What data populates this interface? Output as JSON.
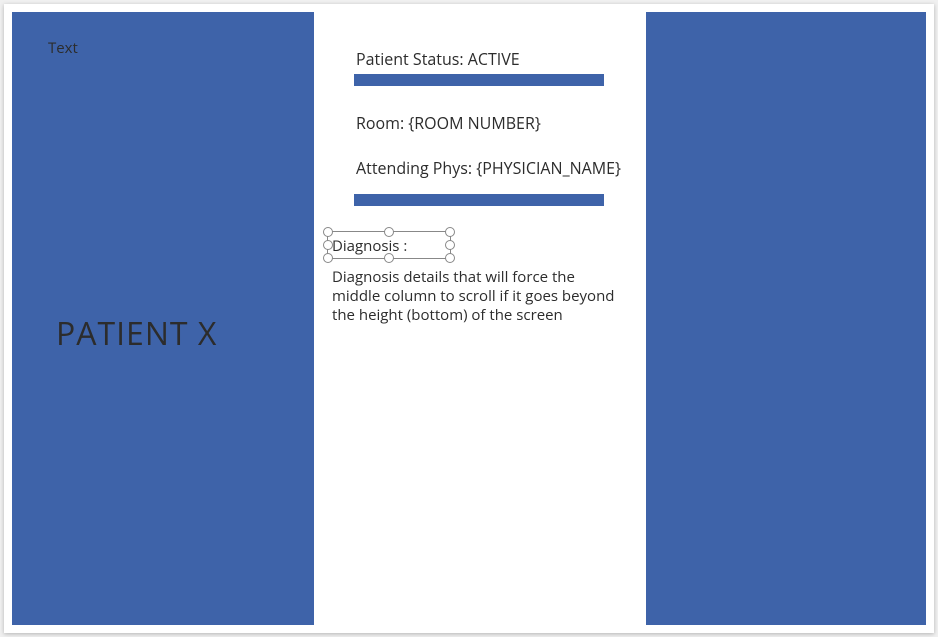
{
  "colors": {
    "panel": "#3E63A9"
  },
  "left": {
    "text_label": "Text",
    "patient_title": "PATIENT X"
  },
  "center": {
    "status_prefix": "Patient Status: ",
    "status_value": "ACTIVE",
    "room_prefix": "Room: ",
    "room_value": "{ROOM NUMBER}",
    "phys_prefix": "Attending Phys:  ",
    "phys_value": "{PHYSICIAN_NAME}",
    "diagnosis_label": "Diagnosis :",
    "diagnosis_details": "Diagnosis details that will force the middle column to scroll if it goes beyond the height (bottom) of the screen"
  }
}
